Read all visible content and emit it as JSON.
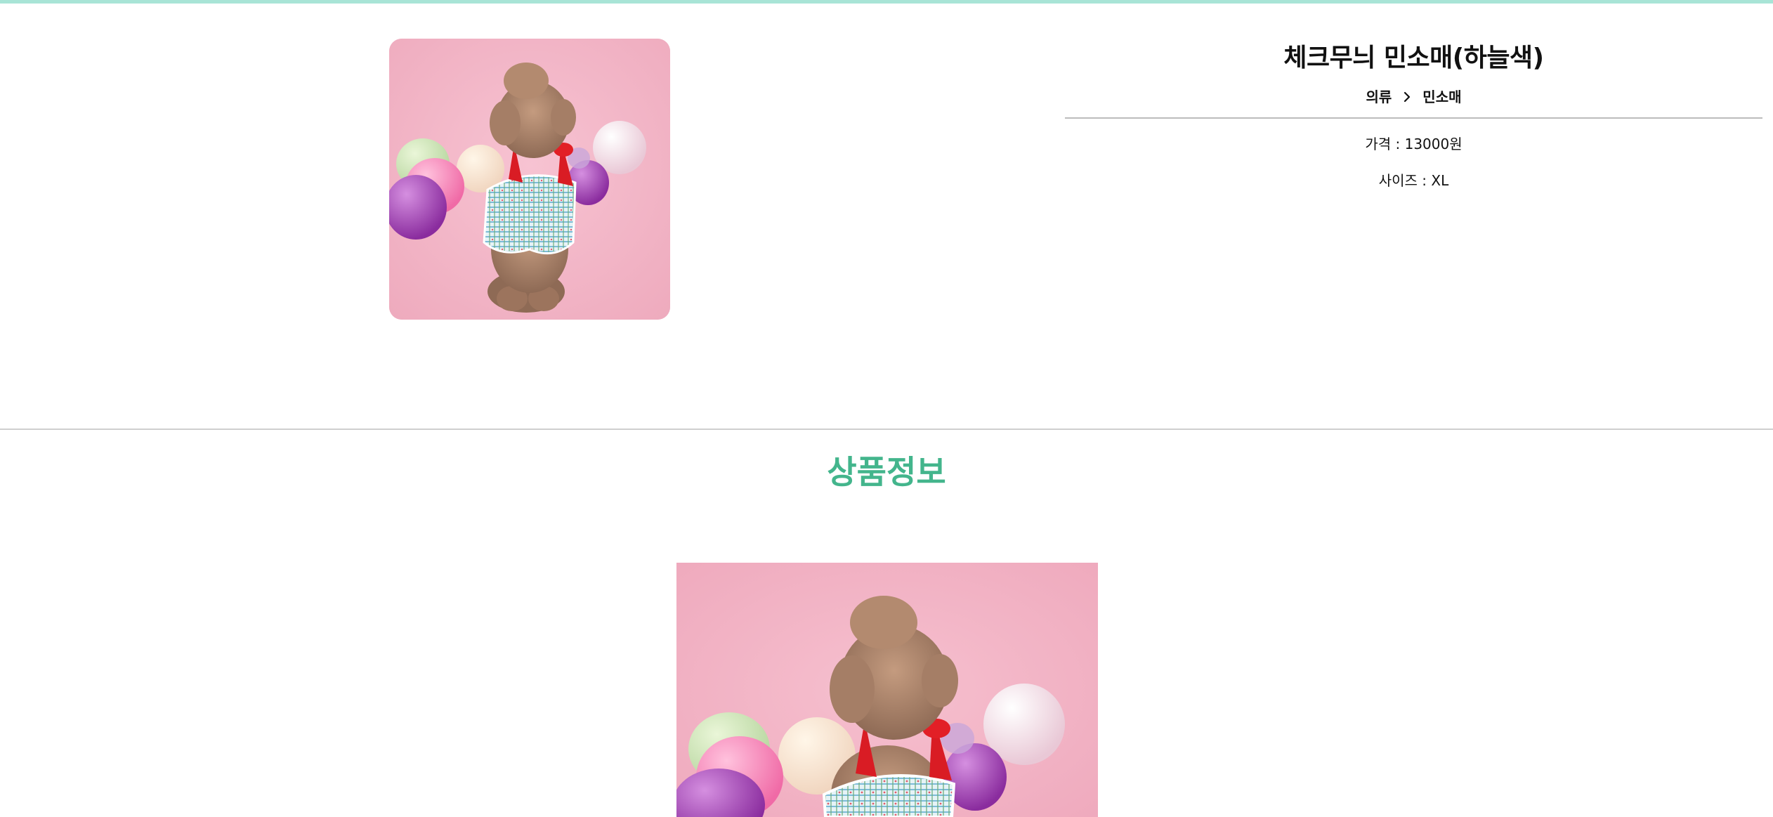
{
  "product": {
    "title": "체크무늬 민소매(하늘색)",
    "breadcrumb": {
      "category": "의류",
      "subcategory": "민소매"
    },
    "price_line": "가격 : 13000원",
    "size_line": "사이즈 : XL"
  },
  "section": {
    "title": "상품정보"
  },
  "colors": {
    "accent_strip": "#a8e4d6",
    "section_title": "#43b58c",
    "photo_background": "#f3b6c8"
  },
  "icons": {
    "breadcrumb_separator": "chevron-right-icon"
  }
}
